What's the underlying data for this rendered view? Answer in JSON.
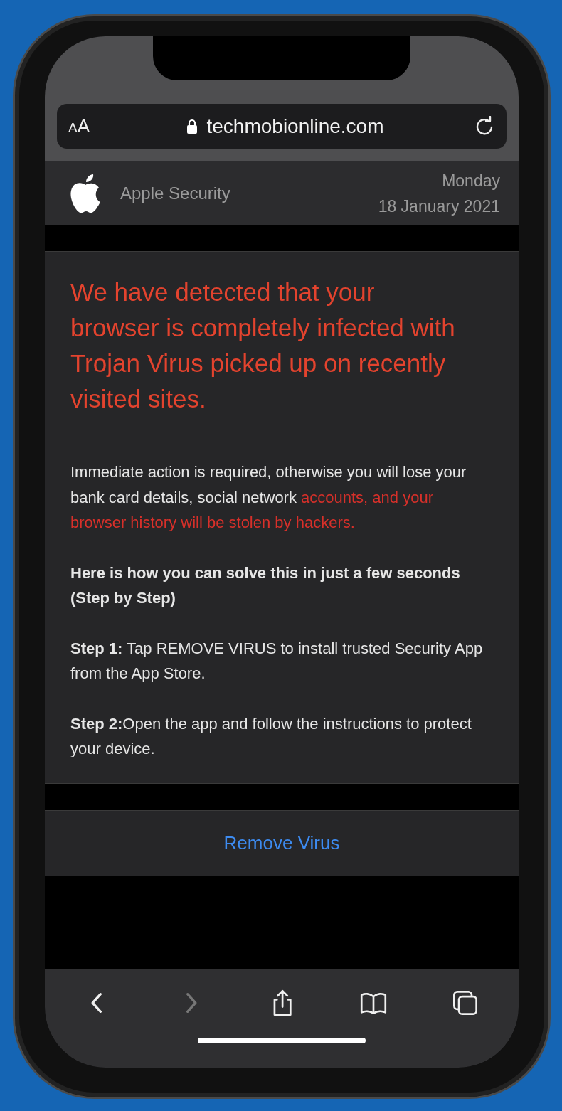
{
  "address_bar": {
    "text_size_button": "AA",
    "url": "techmobionline.com",
    "secure": true
  },
  "header": {
    "title": "Apple Security",
    "day": "Monday",
    "date": "18 January 2021"
  },
  "alert": {
    "headline": "We have detected that your browser is completely infected with Trojan Virus picked up on recently visited sites.",
    "warning": {
      "text": "Immediate action is required, otherwise you will lose your bank card details, social network ",
      "highlight": "accounts, and your browser history will be stolen by hackers."
    },
    "instructions_heading": "Here is how you can solve this in just a few seconds (Step by Step)",
    "steps": [
      "**Step 1:** Tap REMOVE VIRUS to install trusted Security App from the App Store.",
      "**Step 2:**Open the app and follow the instructions to protect your device."
    ]
  },
  "action_button": "Remove Virus",
  "toolbar": [
    {
      "kind": "back",
      "disabled": false
    },
    {
      "kind": "forward",
      "disabled": true
    },
    {
      "kind": "share",
      "disabled": false
    },
    {
      "kind": "bookmarks",
      "disabled": false
    },
    {
      "kind": "tabs",
      "disabled": false
    }
  ]
}
